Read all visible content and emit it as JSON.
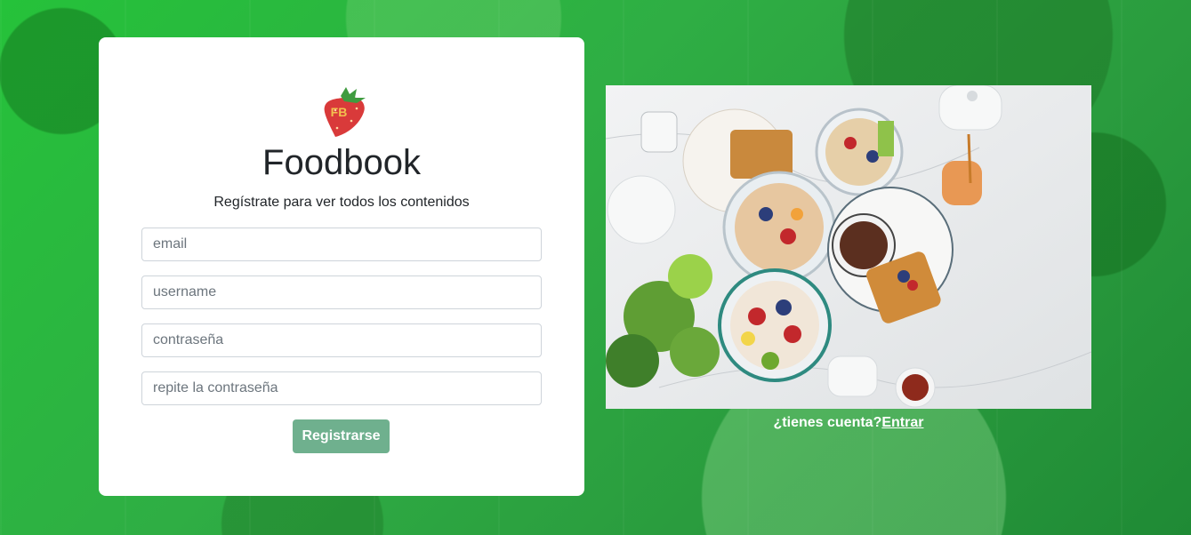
{
  "brand": {
    "name": "Foodbook",
    "logo_text": "FB",
    "logo_icon": "strawberry-icon"
  },
  "form": {
    "subtitle": "Regístrate para ver todos los contenidos",
    "email_placeholder": "email",
    "username_placeholder": "username",
    "password_placeholder": "contraseña",
    "repeat_password_placeholder": "repite la contraseña",
    "submit_label": "Registrarse"
  },
  "login_prompt": {
    "question": "¿tienes cuenta?",
    "link_label": "Entrar"
  },
  "colors": {
    "background": "#2fb53f",
    "button": "#6fb08e",
    "card": "#ffffff",
    "text": "#212529"
  }
}
